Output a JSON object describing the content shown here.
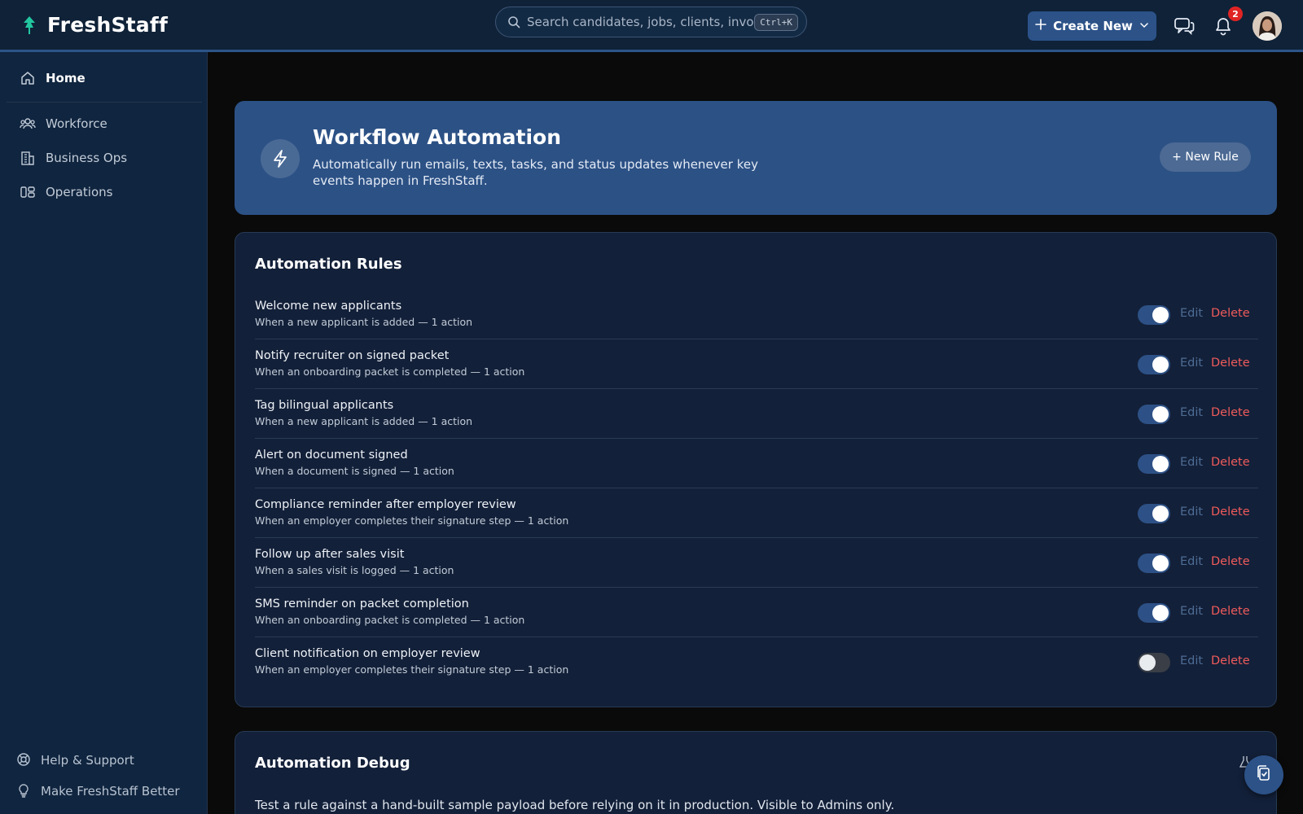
{
  "app": {
    "brand_name": "FreshStaff",
    "brand_icon": "leaf-pin-icon"
  },
  "header": {
    "search": {
      "placeholder": "Search candidates, jobs, clients, invoices...",
      "shortcut": "Ctrl+K"
    },
    "create_label": "Create New",
    "notifications_count": "2"
  },
  "sidebar": {
    "items": [
      {
        "label": "Home",
        "icon": "home-icon",
        "active": true
      },
      {
        "label": "Workforce",
        "icon": "people-icon"
      },
      {
        "label": "Business Ops",
        "icon": "building-icon"
      },
      {
        "label": "Operations",
        "icon": "operations-icon"
      }
    ],
    "footer": [
      {
        "label": "Help & Support",
        "icon": "lifebuoy-icon"
      },
      {
        "label": "Make FreshStaff Better",
        "icon": "lightbulb-icon"
      }
    ]
  },
  "hero": {
    "title": "Workflow Automation",
    "description": "Automatically run emails, texts, tasks, and status updates whenever key events happen in FreshStaff.",
    "new_rule_label": "+ New Rule"
  },
  "rules_panel": {
    "title": "Automation Rules",
    "edit_label": "Edit",
    "delete_label": "Delete",
    "rules": [
      {
        "name": "Welcome new applicants",
        "desc": "When a new applicant is added — 1 action",
        "enabled": true
      },
      {
        "name": "Notify recruiter on signed packet",
        "desc": "When an onboarding packet is completed — 1 action",
        "enabled": true
      },
      {
        "name": "Tag bilingual applicants",
        "desc": "When a new applicant is added — 1 action",
        "enabled": true
      },
      {
        "name": "Alert on document signed",
        "desc": "When a document is signed — 1 action",
        "enabled": true
      },
      {
        "name": "Compliance reminder after employer review",
        "desc": "When an employer completes their signature step — 1 action",
        "enabled": true
      },
      {
        "name": "Follow up after sales visit",
        "desc": "When a sales visit is logged — 1 action",
        "enabled": true
      },
      {
        "name": "SMS reminder on packet completion",
        "desc": "When an onboarding packet is completed — 1 action",
        "enabled": true
      },
      {
        "name": "Client notification on employer review",
        "desc": "When an employer completes their signature step — 1 action",
        "enabled": false
      }
    ]
  },
  "debug_panel": {
    "title": "Automation Debug",
    "description": "Test a rule against a hand-built sample payload before relying on it in production. Visible to Admins only."
  },
  "colors": {
    "accent": "#2c5288",
    "danger": "#ef5b5b",
    "topbar": "#0f2238",
    "sidebar": "#10253f",
    "hero": "#2c5185"
  }
}
